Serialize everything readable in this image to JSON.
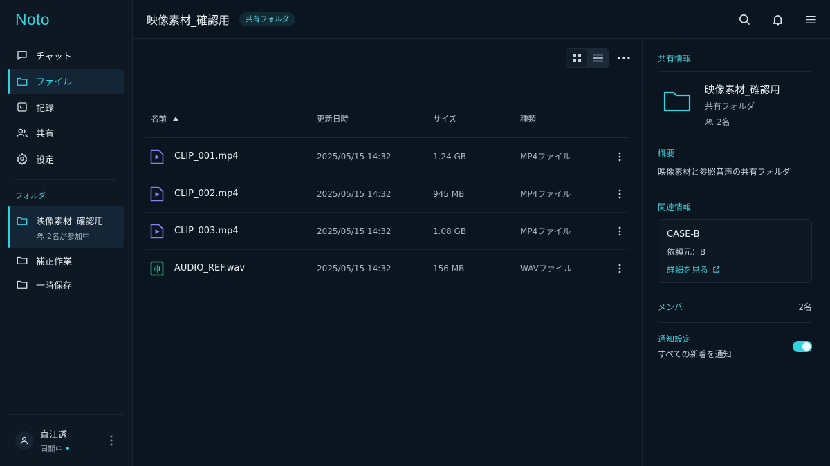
{
  "app": {
    "brand": "Noto"
  },
  "sidebar": {
    "nav": [
      {
        "label": "チャット",
        "icon": "chat-icon"
      },
      {
        "label": "ファイル",
        "icon": "folder-icon",
        "active": true
      },
      {
        "label": "記録",
        "icon": "calendar-icon"
      },
      {
        "label": "共有",
        "icon": "users-icon"
      },
      {
        "label": "設定",
        "icon": "gear-icon"
      }
    ],
    "folders_label": "フォルダ",
    "folders": [
      {
        "label": "映像素材_確認用",
        "sub": "2名が参加中",
        "active": true
      },
      {
        "label": "補正作業"
      },
      {
        "label": "一時保存"
      }
    ],
    "user": {
      "name": "直江透",
      "status": "同期中"
    }
  },
  "header": {
    "title": "映像素材_確認用",
    "badge": "共有フォルダ"
  },
  "table": {
    "columns": {
      "name": "名前",
      "date": "更新日時",
      "size": "サイズ",
      "kind": "種類"
    },
    "rows": [
      {
        "name": "CLIP_001.mp4",
        "date": "2025/05/15 14:32",
        "size": "1.24 GB",
        "kind": "MP4ファイル",
        "type": "video"
      },
      {
        "name": "CLIP_002.mp4",
        "date": "2025/05/15 14:32",
        "size": "945 MB",
        "kind": "MP4ファイル",
        "type": "video"
      },
      {
        "name": "CLIP_003.mp4",
        "date": "2025/05/15 14:32",
        "size": "1.08 GB",
        "kind": "MP4ファイル",
        "type": "video"
      },
      {
        "name": "AUDIO_REF.wav",
        "date": "2025/05/15 14:32",
        "size": "156 MB",
        "kind": "WAVファイル",
        "type": "audio"
      }
    ]
  },
  "panel": {
    "heading": "共有情報",
    "folder": {
      "title": "映像素材_確認用",
      "type": "共有フォルダ",
      "members": "2名"
    },
    "overview_label": "概要",
    "overview": "映像素材と参照音声の共有フォルダ",
    "related_label": "関連情報",
    "related": {
      "title": "CASE-B",
      "requester": "依頼元：B",
      "link": "詳細を見る"
    },
    "members_label": "メンバー",
    "members_count": "2名",
    "notify_label": "通知設定",
    "notify_sub": "すべての新着を通知",
    "notify_on": true
  },
  "colors": {
    "accent": "#2fd4e0",
    "video": "#8b7ff0",
    "audio": "#2fd4a8",
    "bg": "#0b1520"
  }
}
